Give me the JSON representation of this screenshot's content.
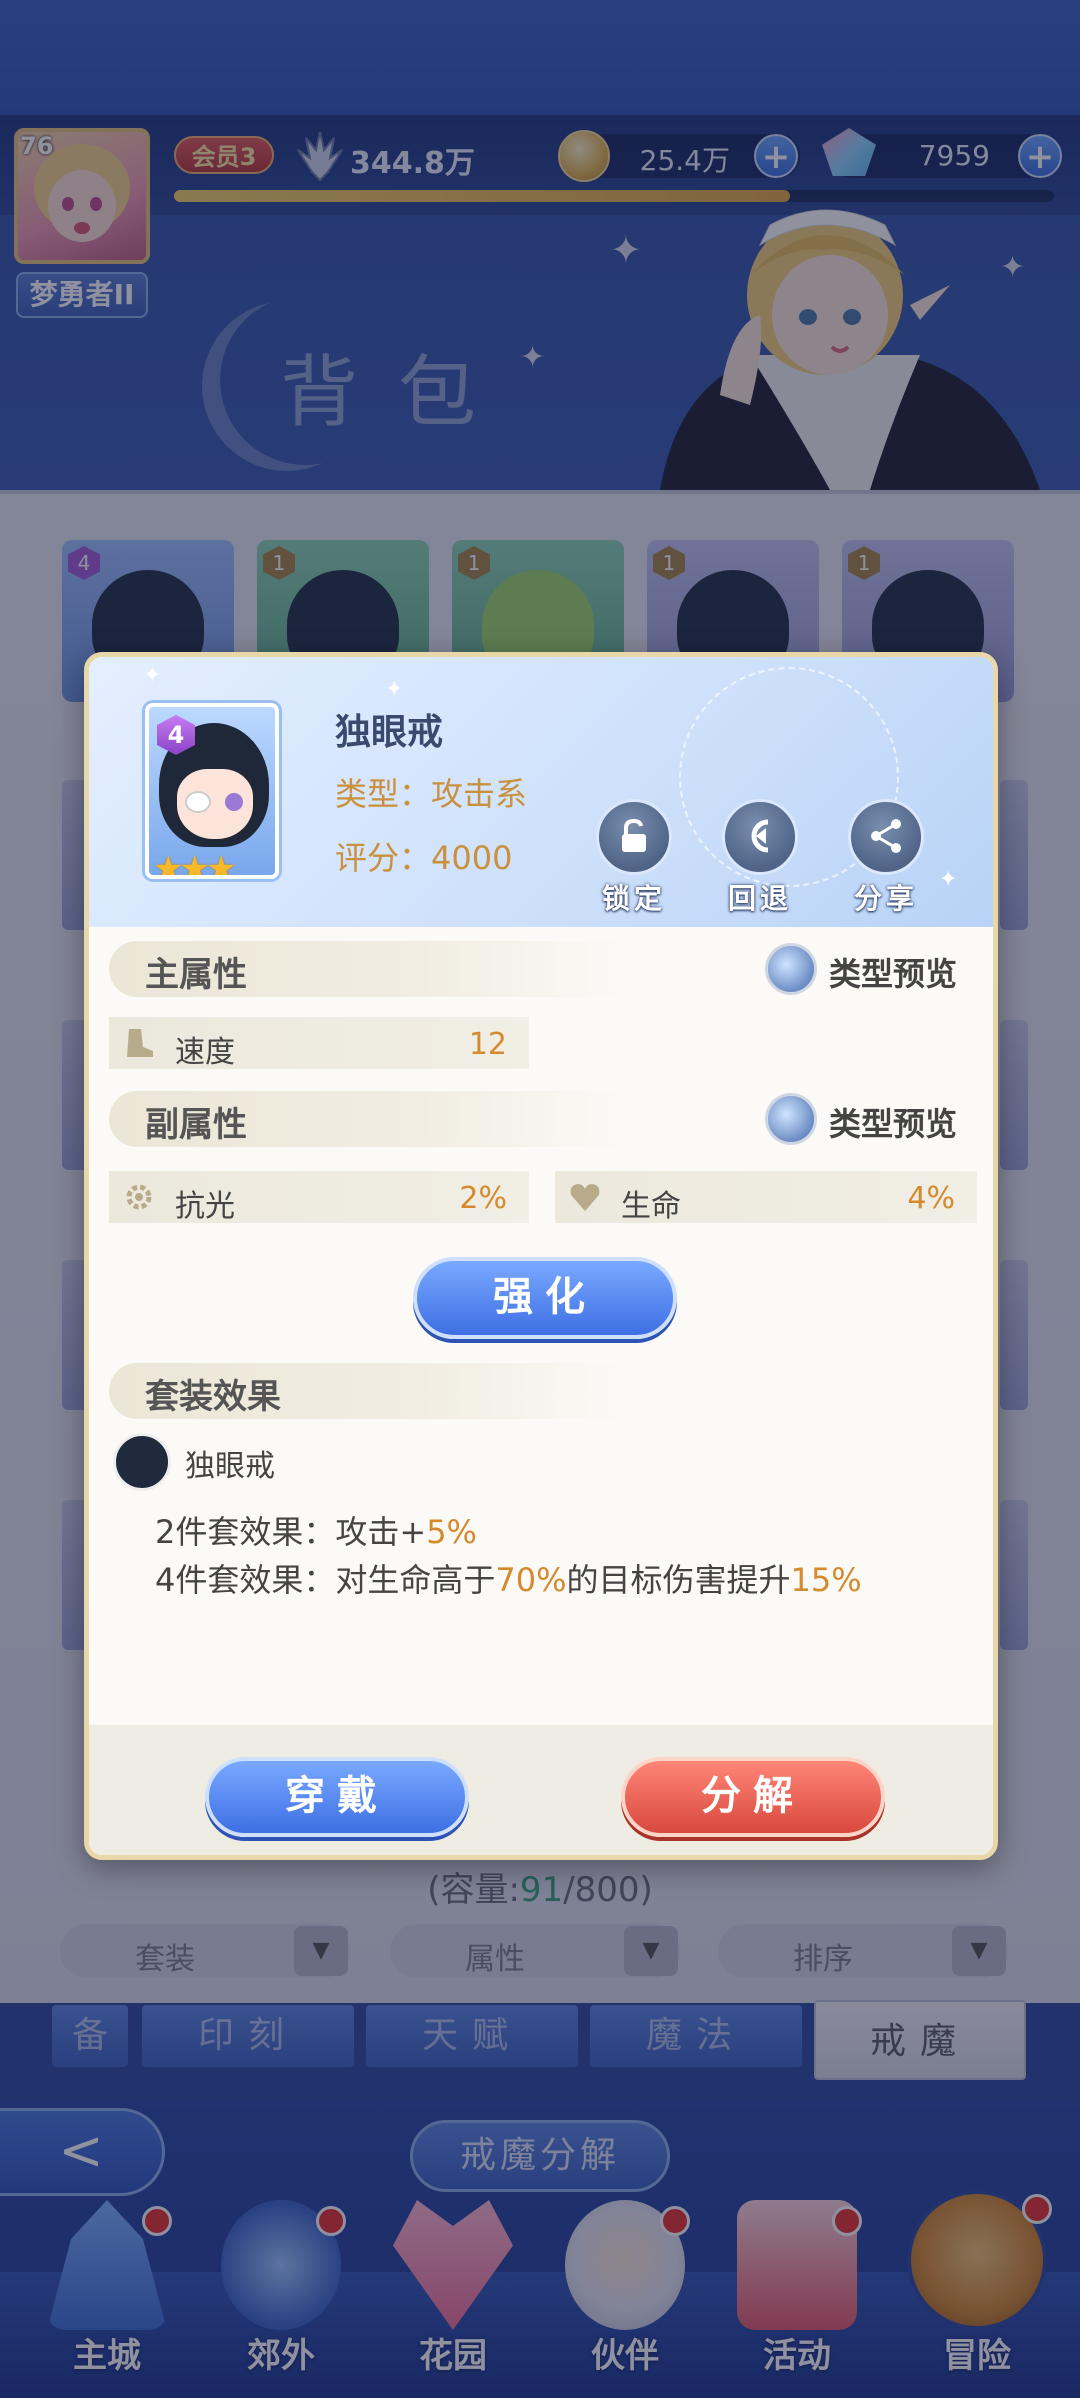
{
  "player": {
    "level": "76",
    "title_badge": "梦勇者II",
    "vip": "会员3",
    "power": "344.8万",
    "exp_fraction": 0.7
  },
  "resources": {
    "coins": "25.4万",
    "gems": "7959",
    "plus_symbol": "+"
  },
  "page": {
    "title": "背包"
  },
  "bag": {
    "capacity_prefix": "(容量:",
    "capacity_used": "91",
    "capacity_total": "/800)",
    "filters": [
      "套装",
      "属性",
      "排序"
    ],
    "slot_ranks": [
      "4",
      "1",
      "1",
      "1",
      "1"
    ]
  },
  "category_tabs": {
    "partial": "备",
    "items": [
      "印刻",
      "天赋",
      "魔法"
    ],
    "active": "戒魔"
  },
  "bottom": {
    "back_symbol": "<",
    "decompose_label": "戒魔分解",
    "nav": [
      "主城",
      "郊外",
      "花园",
      "伙伴",
      "活动",
      "冒险"
    ]
  },
  "item": {
    "rank": "4",
    "stars": "★★★",
    "name": "独眼戒",
    "type_line": "类型：攻击系",
    "score_line": "评分：4000",
    "actions": {
      "lock": "锁定",
      "rollback": "回退",
      "share": "分享"
    },
    "main_attr": {
      "title": "主属性",
      "preview": "类型预览",
      "stats": [
        {
          "name": "速度",
          "value": "12"
        }
      ]
    },
    "sub_attr": {
      "title": "副属性",
      "preview": "类型预览",
      "stats": [
        {
          "name": "抗光",
          "value": "2%"
        },
        {
          "name": "生命",
          "value": "4%"
        }
      ]
    },
    "enhance_label": "强化",
    "set": {
      "title": "套装效果",
      "name": "独眼戒",
      "bonus2": {
        "prefix": "2件套效果：攻击+",
        "value": "5%"
      },
      "bonus4": {
        "prefix": "4件套效果：对生命高于",
        "v1": "70%",
        "mid": "的目标伤害提升",
        "v2": "15%"
      }
    },
    "equip_label": "穿戴",
    "salvage_label": "分解"
  },
  "colors": {
    "accent_orange": "#d58a2e",
    "primary_blue": "#3e6fe3",
    "danger_red": "#d9483d",
    "capacity_green": "#3aa37a"
  },
  "icons": {
    "lock": "lock-icon",
    "rollback": "rollback-icon",
    "share": "share-icon",
    "preview": "magnifier-icon",
    "speed": "boot-icon",
    "light_resist": "gear-icon",
    "life": "heart-icon",
    "power": "trident-icon",
    "coin": "coin-icon",
    "gem": "gem-icon"
  }
}
